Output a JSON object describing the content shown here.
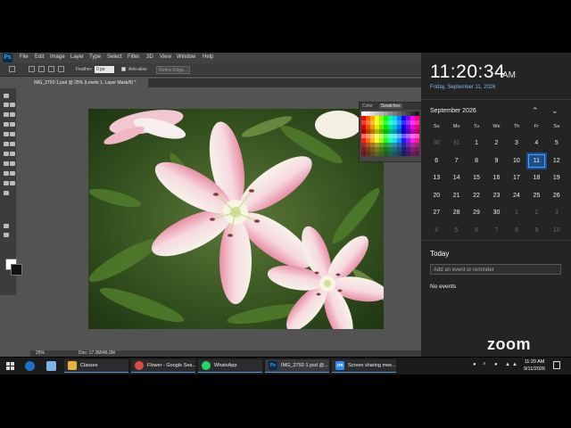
{
  "photoshop": {
    "logo": "Ps",
    "menu": [
      "File",
      "Edit",
      "Image",
      "Layer",
      "Type",
      "Select",
      "Filter",
      "3D",
      "View",
      "Window",
      "Help"
    ],
    "options": {
      "feather_label": "Feather:",
      "feather_value": "0 px",
      "antialias_label": "Anti-alias",
      "refine_edge": "Refine Edge..."
    },
    "document_tab": "IMG_2792-1.psd @ 25% (Levels 1, Layer Mask/8) *",
    "status": {
      "zoom": "25%",
      "doc_size": "Doc: 17.3M/46.3M"
    },
    "swatches_tabs": [
      "Color",
      "Swatches"
    ],
    "colors": {
      "foreground": "#ffffff",
      "background": "#111111"
    }
  },
  "calendar": {
    "time": "11:20:34",
    "ampm": "AM",
    "full_date": "Friday, September 11, 2026",
    "month_label": "September 2026",
    "weekdays": [
      "Su",
      "Mo",
      "Tu",
      "We",
      "Th",
      "Fr",
      "Sa"
    ],
    "days": [
      [
        "30",
        "31",
        "1",
        "2",
        "3",
        "4",
        "5"
      ],
      [
        "6",
        "7",
        "8",
        "9",
        "10",
        "11",
        "12"
      ],
      [
        "13",
        "14",
        "15",
        "16",
        "17",
        "18",
        "19"
      ],
      [
        "20",
        "21",
        "22",
        "23",
        "24",
        "25",
        "26"
      ],
      [
        "27",
        "28",
        "29",
        "30",
        "1",
        "2",
        "3"
      ],
      [
        "4",
        "5",
        "6",
        "7",
        "8",
        "9",
        "10"
      ]
    ],
    "today_label": "Today",
    "event_placeholder": "Add an event or reminder",
    "no_events": "No events"
  },
  "zoom_logo": "zoom",
  "taskbar": {
    "tasks": [
      {
        "label": "Classes",
        "icon": "folder-icon"
      },
      {
        "label": "Flower - Google Sea...",
        "icon": "chrome-icon"
      },
      {
        "label": "WhatsApp",
        "icon": "whatsapp-icon"
      },
      {
        "label": "IMG_2792-1.psd @...",
        "icon": "photoshop-icon"
      },
      {
        "label": "Screen sharing mee...",
        "icon": "zoom-icon"
      }
    ],
    "clock_time": "11:20 AM",
    "clock_date": "9/11/2026",
    "accent": "#5a9be0"
  }
}
